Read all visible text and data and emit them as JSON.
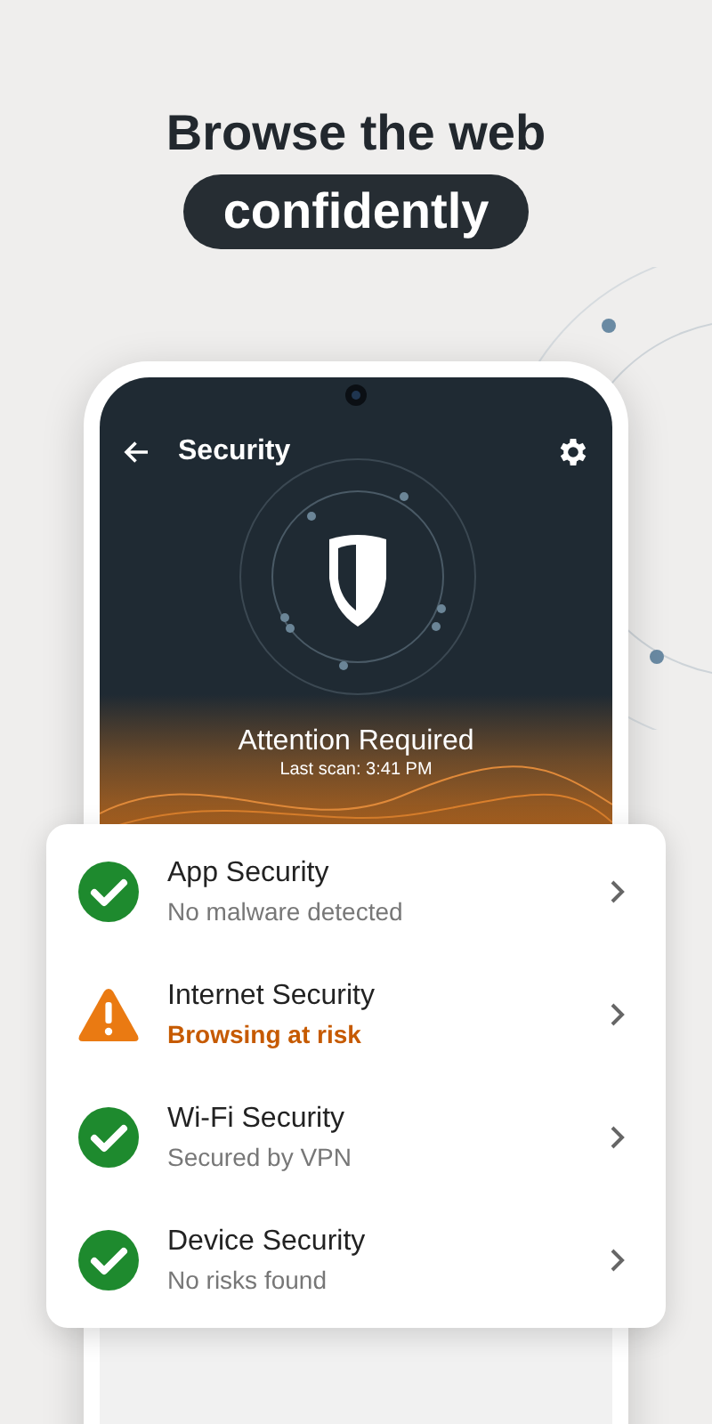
{
  "headline": {
    "title": "Browse the web",
    "highlight": "confidently"
  },
  "screen": {
    "title": "Security",
    "status": {
      "title": "Attention Required",
      "last_scan": "Last scan: 3:41 PM"
    }
  },
  "items": [
    {
      "kind": "ok",
      "title": "App Security",
      "subtitle": "No malware detected"
    },
    {
      "kind": "warning",
      "title": "Internet Security",
      "subtitle": "Browsing at risk"
    },
    {
      "kind": "ok",
      "title": "Wi-Fi Security",
      "subtitle": "Secured by VPN"
    },
    {
      "kind": "ok",
      "title": "Device Security",
      "subtitle": "No risks found"
    }
  ]
}
